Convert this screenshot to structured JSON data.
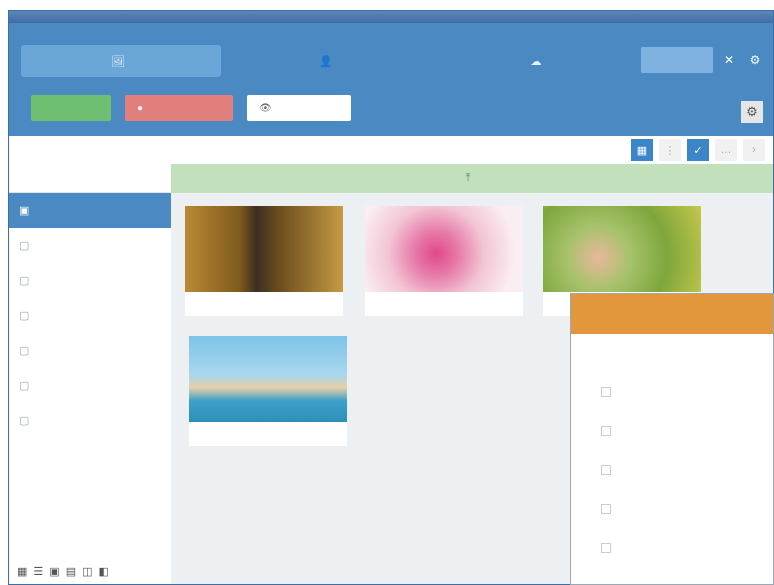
{
  "nav": {
    "tabs": [
      {
        "label": "",
        "icon": "image-icon"
      },
      {
        "label": "",
        "icon": "user-icon"
      },
      {
        "label": "",
        "icon": "cloud-icon"
      }
    ],
    "search_placeholder": "",
    "right_buttons": [
      "close-icon",
      "settings-icon"
    ]
  },
  "actions": {
    "green_label": "",
    "red_label": "",
    "white_label": ""
  },
  "sidebar": {
    "header": "",
    "items": [
      {
        "label": "",
        "active": true
      },
      {
        "label": "",
        "active": false
      },
      {
        "label": "",
        "active": false
      },
      {
        "label": "",
        "active": false
      },
      {
        "label": "",
        "active": false
      },
      {
        "label": "",
        "active": false
      },
      {
        "label": "",
        "active": false
      }
    ]
  },
  "toolbar": {
    "path": ""
  },
  "upload_bar": {
    "label": ""
  },
  "cards": [
    {
      "name": "",
      "meta": ""
    },
    {
      "name": "",
      "meta": ""
    },
    {
      "name": "",
      "meta": ""
    },
    {
      "name": "",
      "meta": ""
    }
  ],
  "panel": {
    "tabs": [
      "",
      ""
    ],
    "items": [
      "",
      "",
      "",
      "",
      ""
    ]
  },
  "colors": {
    "topbar": "#4a89c2",
    "panel_header": "#e3973c",
    "upload_bar": "#c3e0bd",
    "btn_green": "#6fbf72",
    "btn_red": "#e07f7b"
  }
}
